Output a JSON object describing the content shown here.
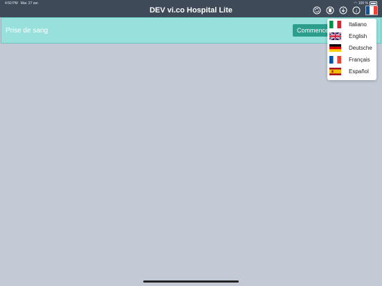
{
  "status": {
    "time": "4:50 PM",
    "date": "Mar. 27 avr.",
    "battery": "100 %"
  },
  "header": {
    "title": "DEV vi.co Hospital Lite"
  },
  "icons": [
    "sync-icon",
    "delete-icon",
    "download-icon",
    "info-icon",
    "french-flag-icon"
  ],
  "task": {
    "title": "Prise de sang",
    "start_label": "Commencer"
  },
  "languages": [
    {
      "label": "Italiano",
      "flag": "italy"
    },
    {
      "label": "English",
      "flag": "uk"
    },
    {
      "label": "Deutsche",
      "flag": "germany"
    },
    {
      "label": "Français",
      "flag": "france"
    },
    {
      "label": "Español",
      "flag": "spain"
    }
  ],
  "colors": {
    "header": "#3f4a59",
    "task_bar": "#97e0dc",
    "button": "#2b9e8e",
    "background": "#c3cad5"
  }
}
